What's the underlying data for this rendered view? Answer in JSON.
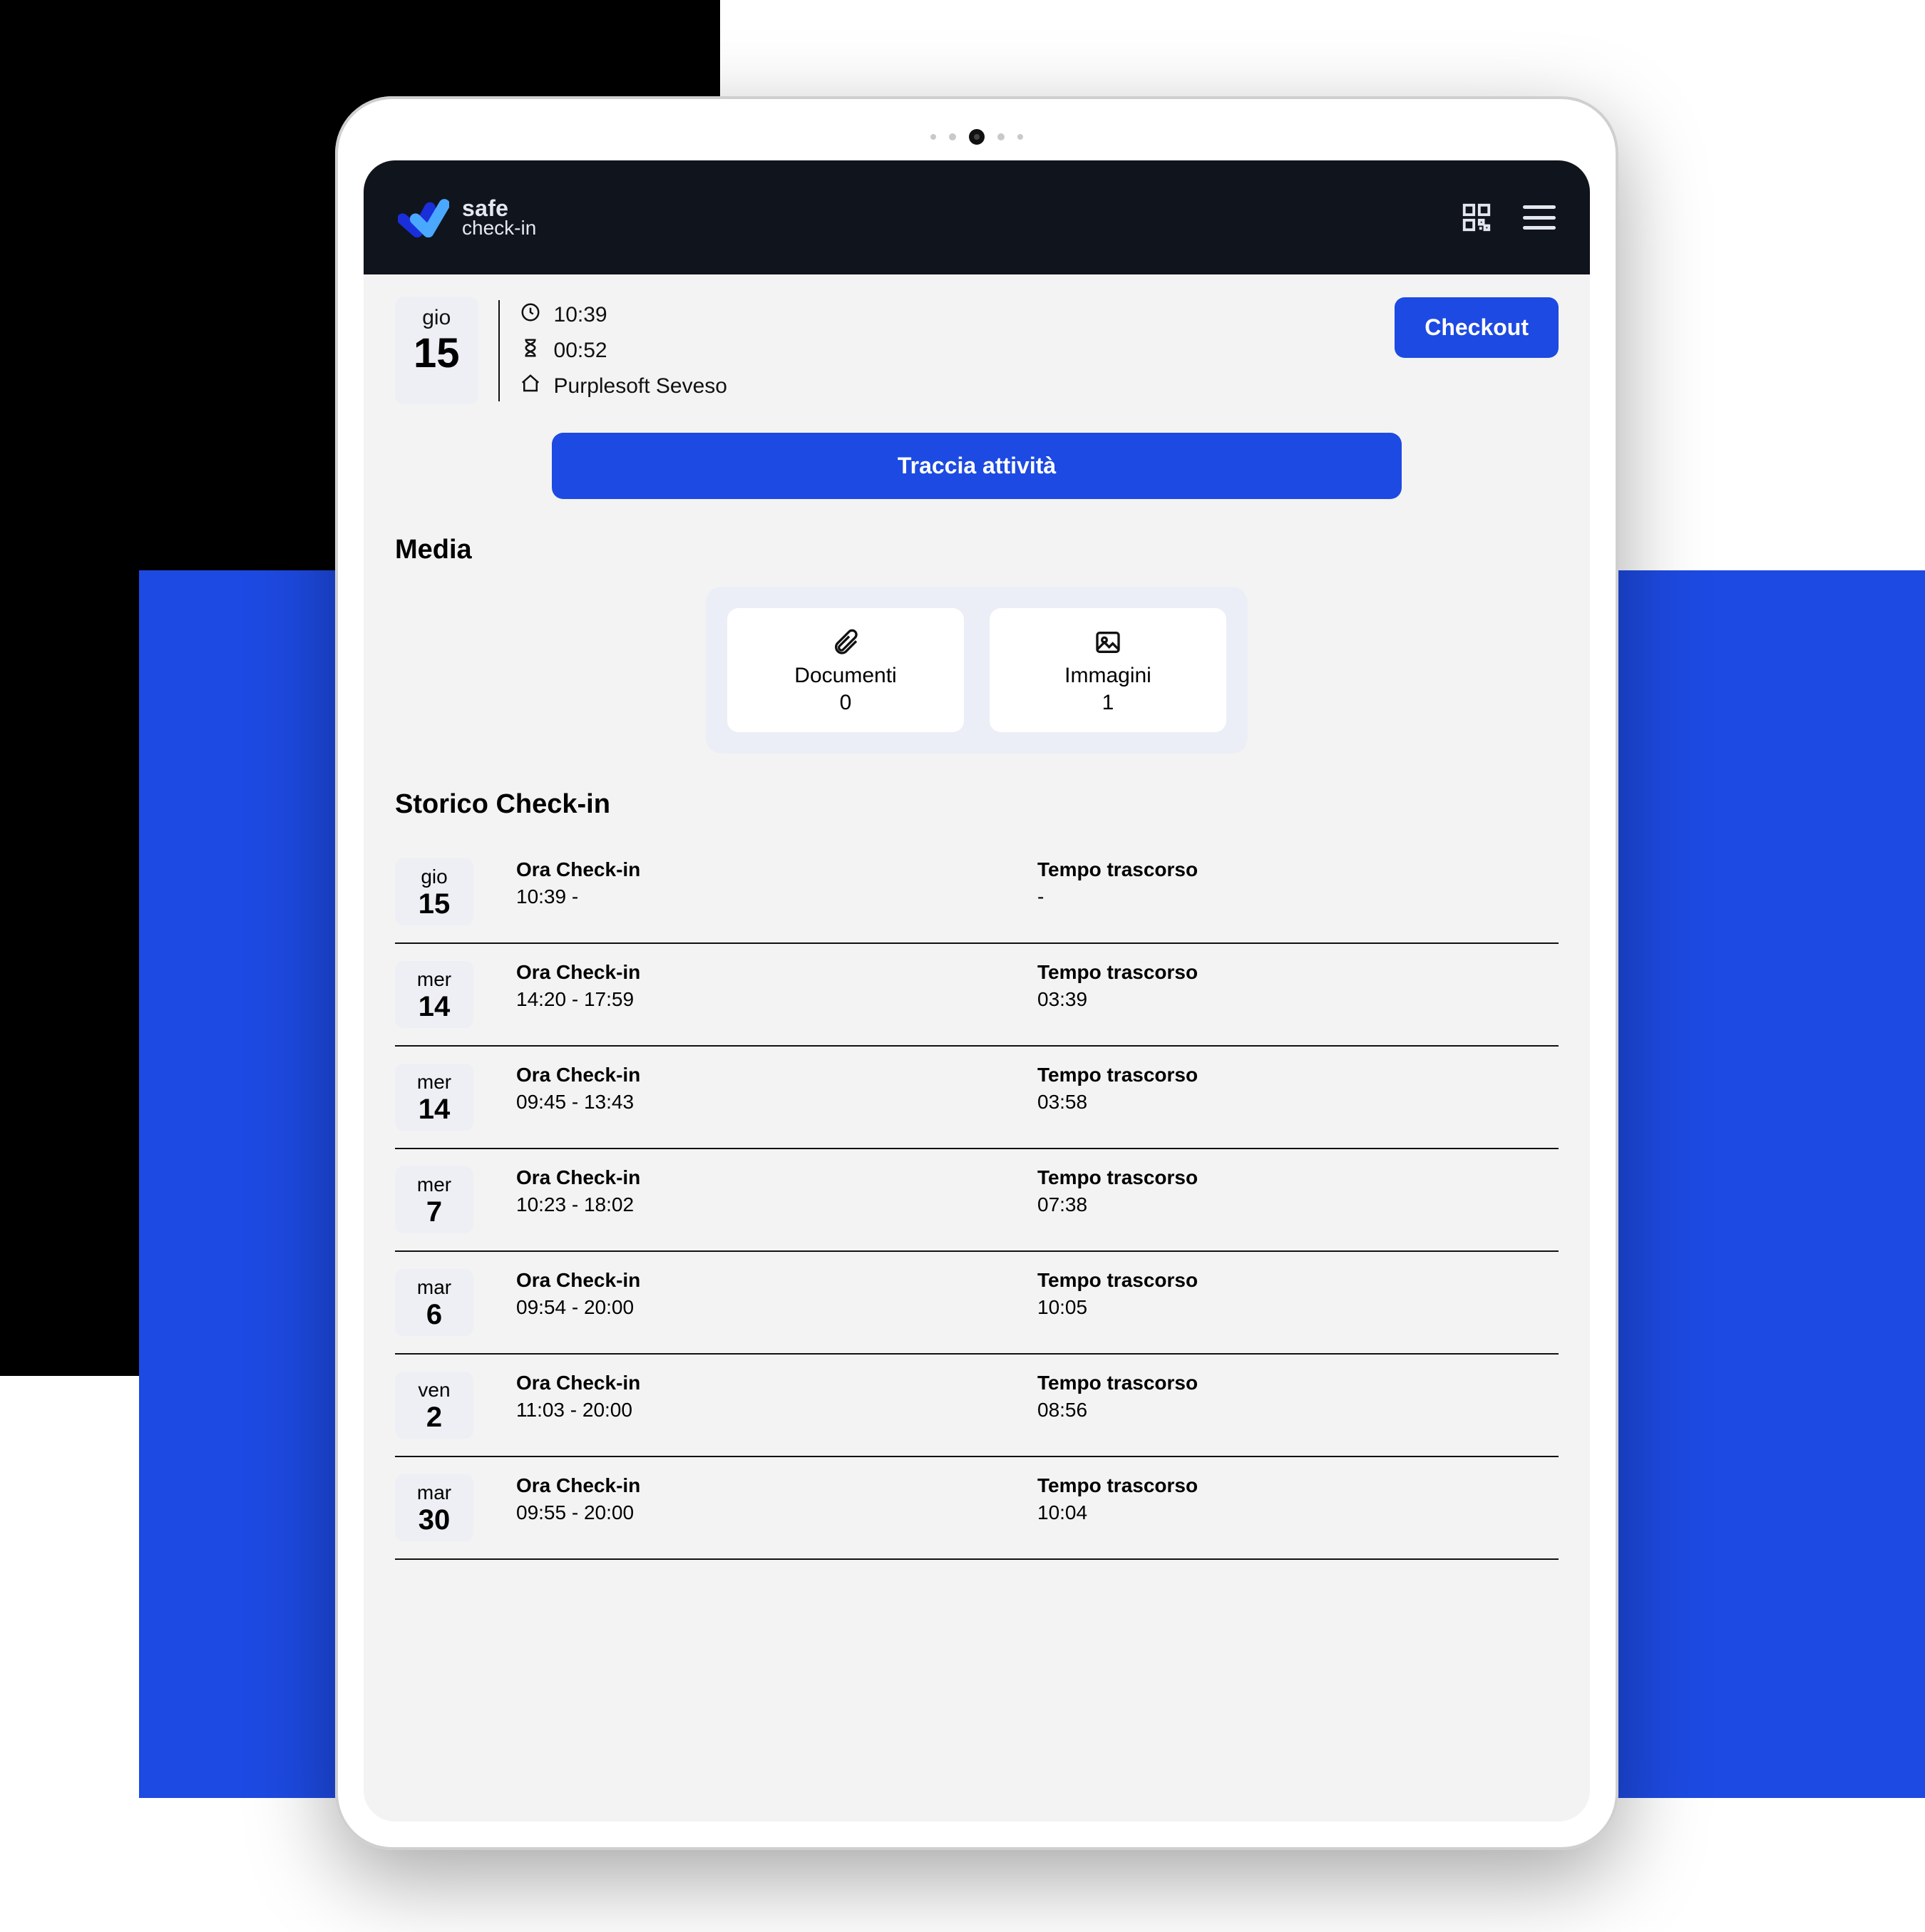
{
  "brand": {
    "line1": "safe",
    "line2": "check-in"
  },
  "session": {
    "dow": "gio",
    "day": "15",
    "clock_time": "10:39",
    "elapsed": "00:52",
    "location": "Purplesoft Seveso"
  },
  "buttons": {
    "checkout": "Checkout",
    "track": "Traccia attività"
  },
  "sections": {
    "media": "Media",
    "history": "Storico Check-in"
  },
  "media": {
    "documents": {
      "label": "Documenti",
      "count": "0"
    },
    "images": {
      "label": "Immagini",
      "count": "1"
    }
  },
  "history_labels": {
    "checkin": "Ora Check-in",
    "elapsed": "Tempo trascorso"
  },
  "history": [
    {
      "dow": "gio",
      "day": "15",
      "checkin": "10:39 -",
      "elapsed": "-"
    },
    {
      "dow": "mer",
      "day": "14",
      "checkin": "14:20 - 17:59",
      "elapsed": "03:39"
    },
    {
      "dow": "mer",
      "day": "14",
      "checkin": "09:45 - 13:43",
      "elapsed": "03:58"
    },
    {
      "dow": "mer",
      "day": "7",
      "checkin": "10:23 - 18:02",
      "elapsed": "07:38"
    },
    {
      "dow": "mar",
      "day": "6",
      "checkin": "09:54 - 20:00",
      "elapsed": "10:05"
    },
    {
      "dow": "ven",
      "day": "2",
      "checkin": "11:03 - 20:00",
      "elapsed": "08:56"
    },
    {
      "dow": "mar",
      "day": "30",
      "checkin": "09:55 - 20:00",
      "elapsed": "10:04"
    }
  ]
}
